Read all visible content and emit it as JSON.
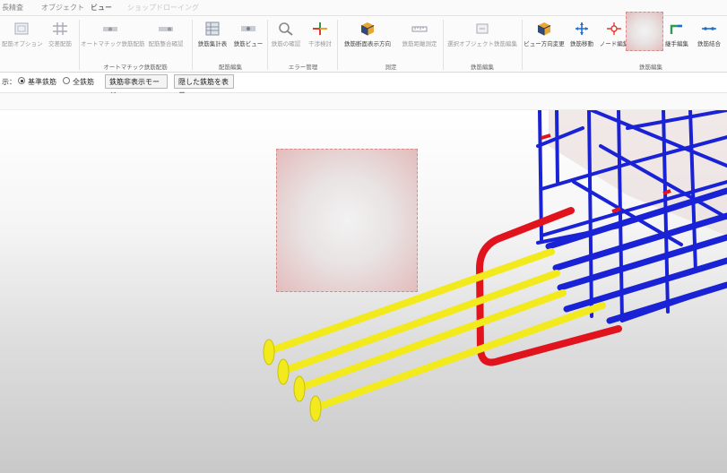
{
  "tabs": [
    {
      "label": "長精査",
      "state": "normal"
    },
    {
      "label": "オブジェクト",
      "state": "normal"
    },
    {
      "label": "ビュー",
      "state": "active"
    },
    {
      "label": "ショップドローイング",
      "state": "disabled"
    }
  ],
  "ribbon": {
    "buttons": [
      {
        "label": "配筋オプション",
        "icon": "rebar-option-icon"
      },
      {
        "label": "交差配筋",
        "icon": "cross-grid-icon"
      },
      {
        "label": "オートマチック鉄筋配筋",
        "icon": "auto-rebar-icon"
      },
      {
        "label": "配筋整合確認",
        "icon": "rebar-check-icon"
      },
      {
        "label": "鉄筋集計表",
        "icon": "rebar-table-icon"
      },
      {
        "label": "鉄筋ビュー",
        "icon": "rebar-view-icon"
      },
      {
        "label": "鉄筋の確認",
        "icon": "magnifier-icon"
      },
      {
        "label": "干渉検討",
        "icon": "interference-icon"
      },
      {
        "label": "鉄筋断面表示方向",
        "icon": "cube-icon"
      },
      {
        "label": "鉄筋距離測定",
        "icon": "measure-icon"
      },
      {
        "label": "選択オブジェクト鉄筋編集",
        "icon": "select-edit-icon"
      },
      {
        "label": "ビュー方向変更",
        "icon": "cube-icon"
      },
      {
        "label": "鉄筋移動",
        "icon": "move-icon"
      },
      {
        "label": "ノード編集",
        "icon": "node-edit-icon"
      },
      {
        "label": "継手編集",
        "icon": "joint-edit-icon"
      },
      {
        "label": "鉄筋結合",
        "icon": "join-icon"
      }
    ],
    "groups": [
      {
        "label": "オートマチック鉄筋配筋"
      },
      {
        "label": "配筋編集"
      },
      {
        "label": "エラー管理"
      },
      {
        "label": "測定"
      },
      {
        "label": "鉄筋編集"
      },
      {
        "label": "鉄筋編集"
      }
    ]
  },
  "display_bar": {
    "prefix": "示：",
    "radio_basic": "基準鉄筋",
    "radio_all": "全鉄筋",
    "hide_mode_button": "鉄筋非表示モード",
    "show_hidden_button": "隠した鉄筋を表示"
  },
  "colors": {
    "rebar_blue": "#1a22d6",
    "rebar_yellow": "#f2ea1c",
    "rebar_red": "#e1141e",
    "accent_blue": "#1f6fd1"
  }
}
